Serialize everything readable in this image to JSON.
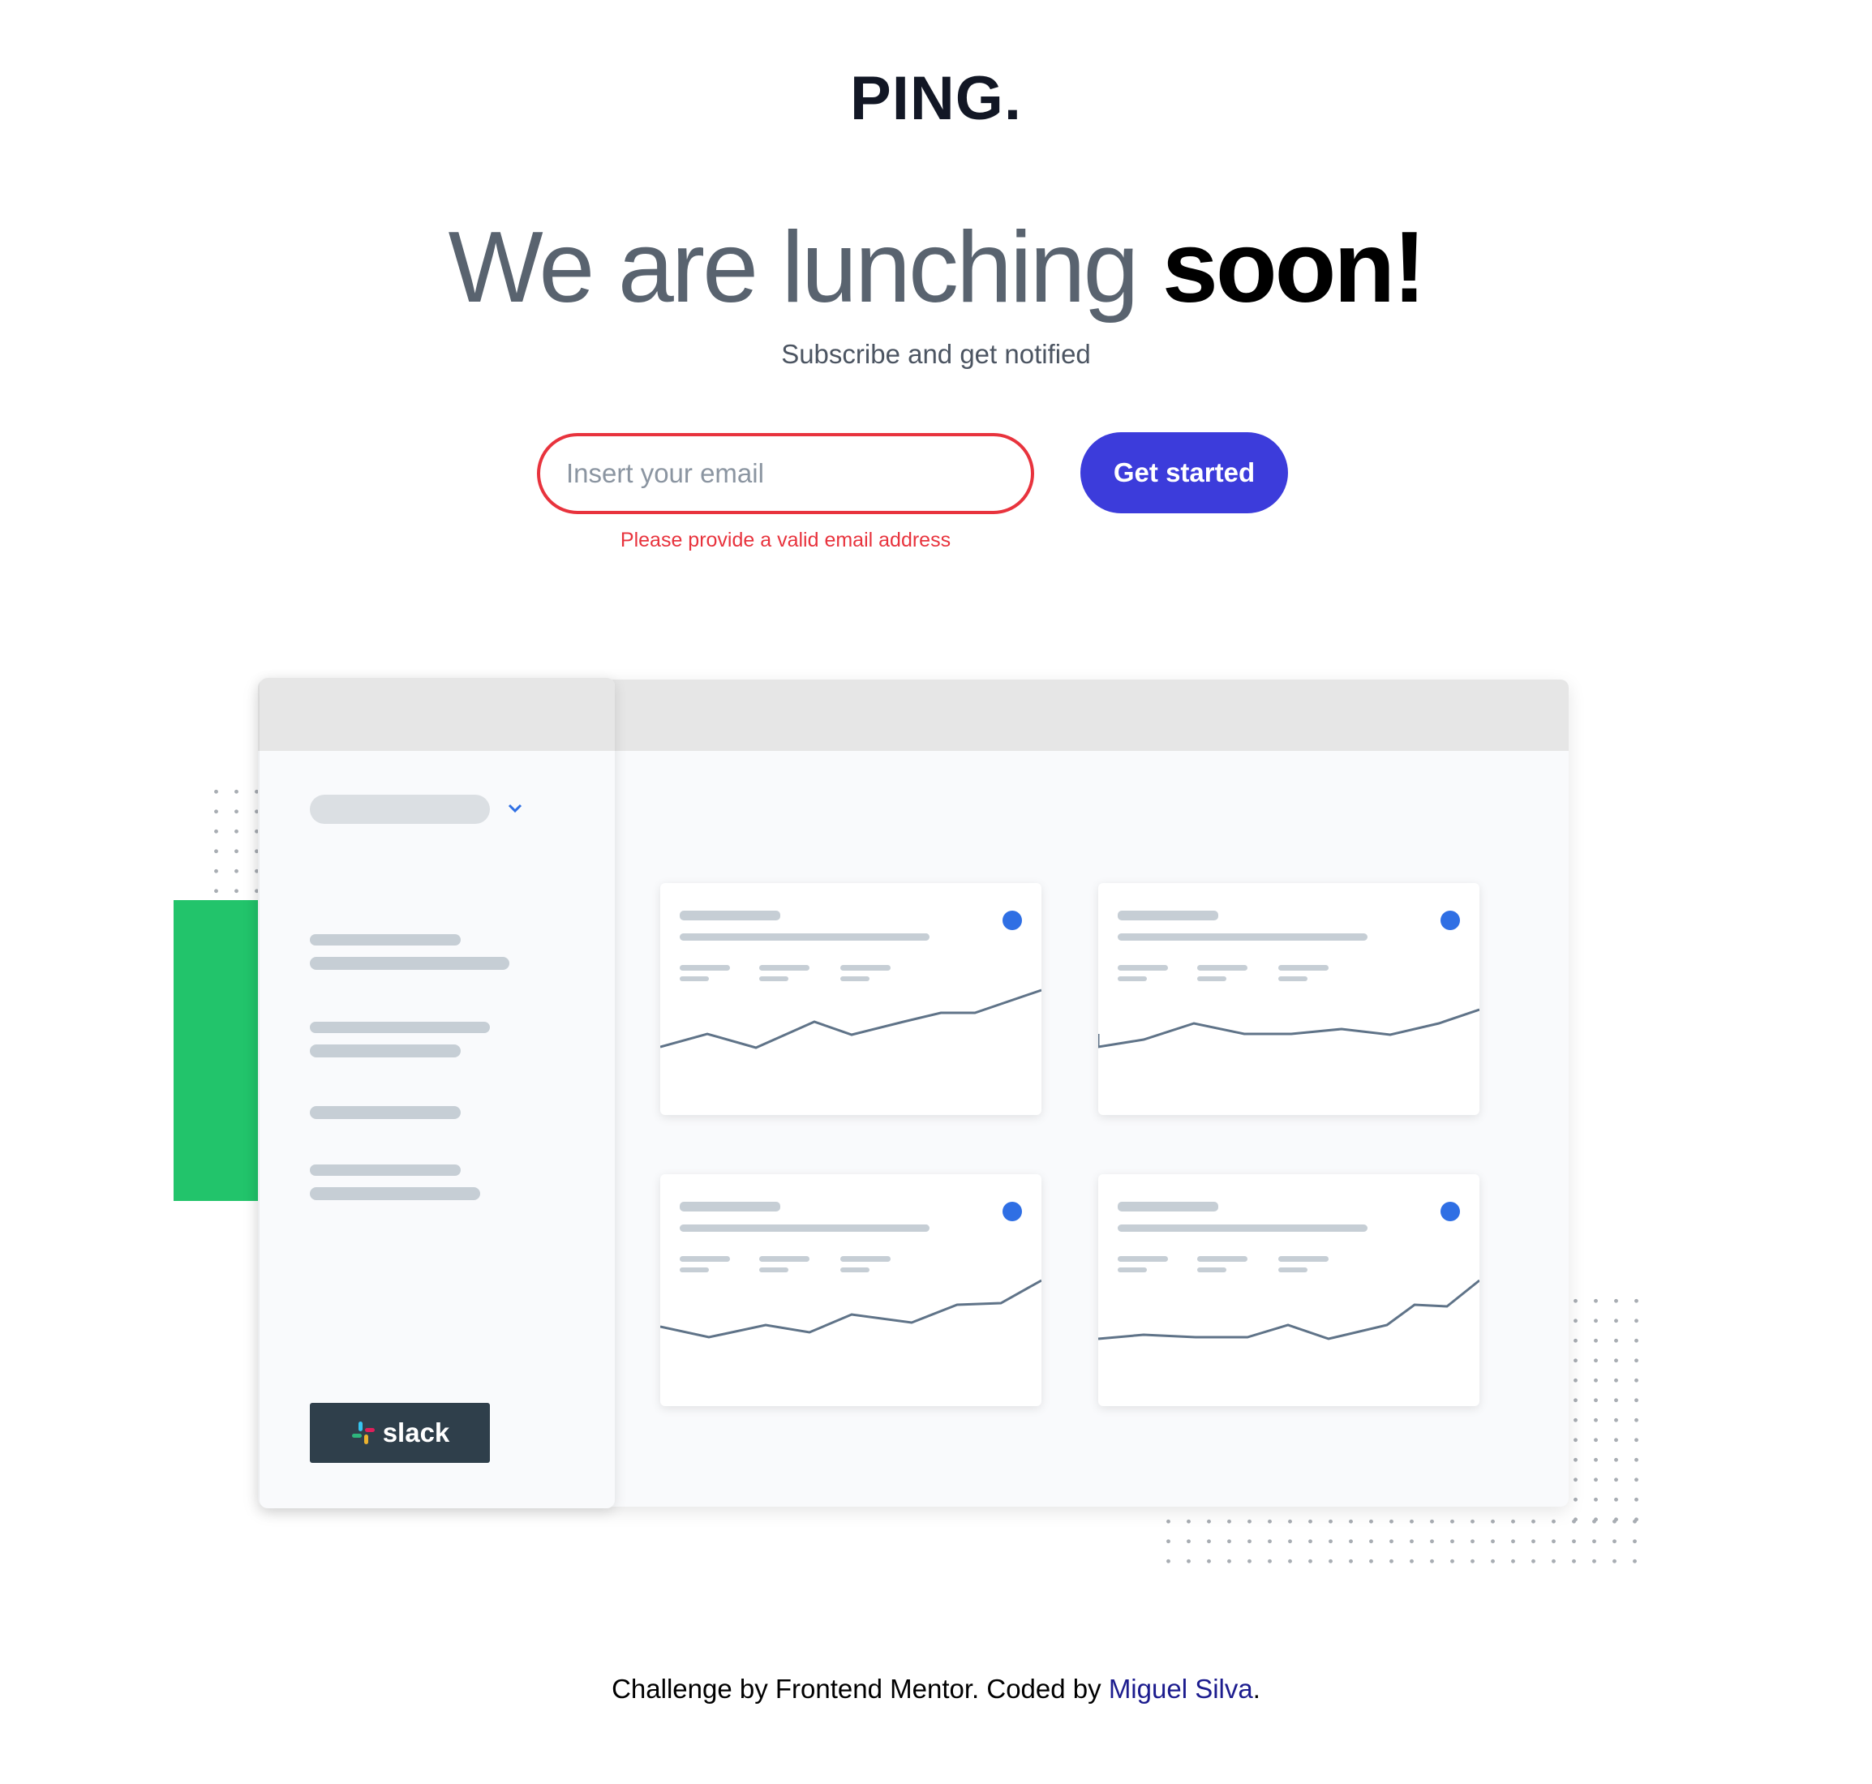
{
  "header": {
    "logo": "PING."
  },
  "hero": {
    "title_light": "We are lunching",
    "title_bold": "soon!",
    "subtitle": "Subscribe and get notified"
  },
  "form": {
    "email_placeholder": "Insert your email",
    "email_value": "",
    "error": "Please provide a valid email address",
    "submit_label": "Get started"
  },
  "illustration": {
    "sidebar_button": "slack",
    "window_dots": [
      "#22c46b",
      "#2f6fe4",
      "#2f3f4b"
    ],
    "cards": 4
  },
  "footer": {
    "prefix": "Challenge by Frontend Mentor. Coded by ",
    "author": "Miguel Silva",
    "suffix": "."
  },
  "colors": {
    "accent": "#3c3cdb",
    "error": "#e8333d",
    "green": "#22c46b",
    "check": "#2f6fe4"
  }
}
